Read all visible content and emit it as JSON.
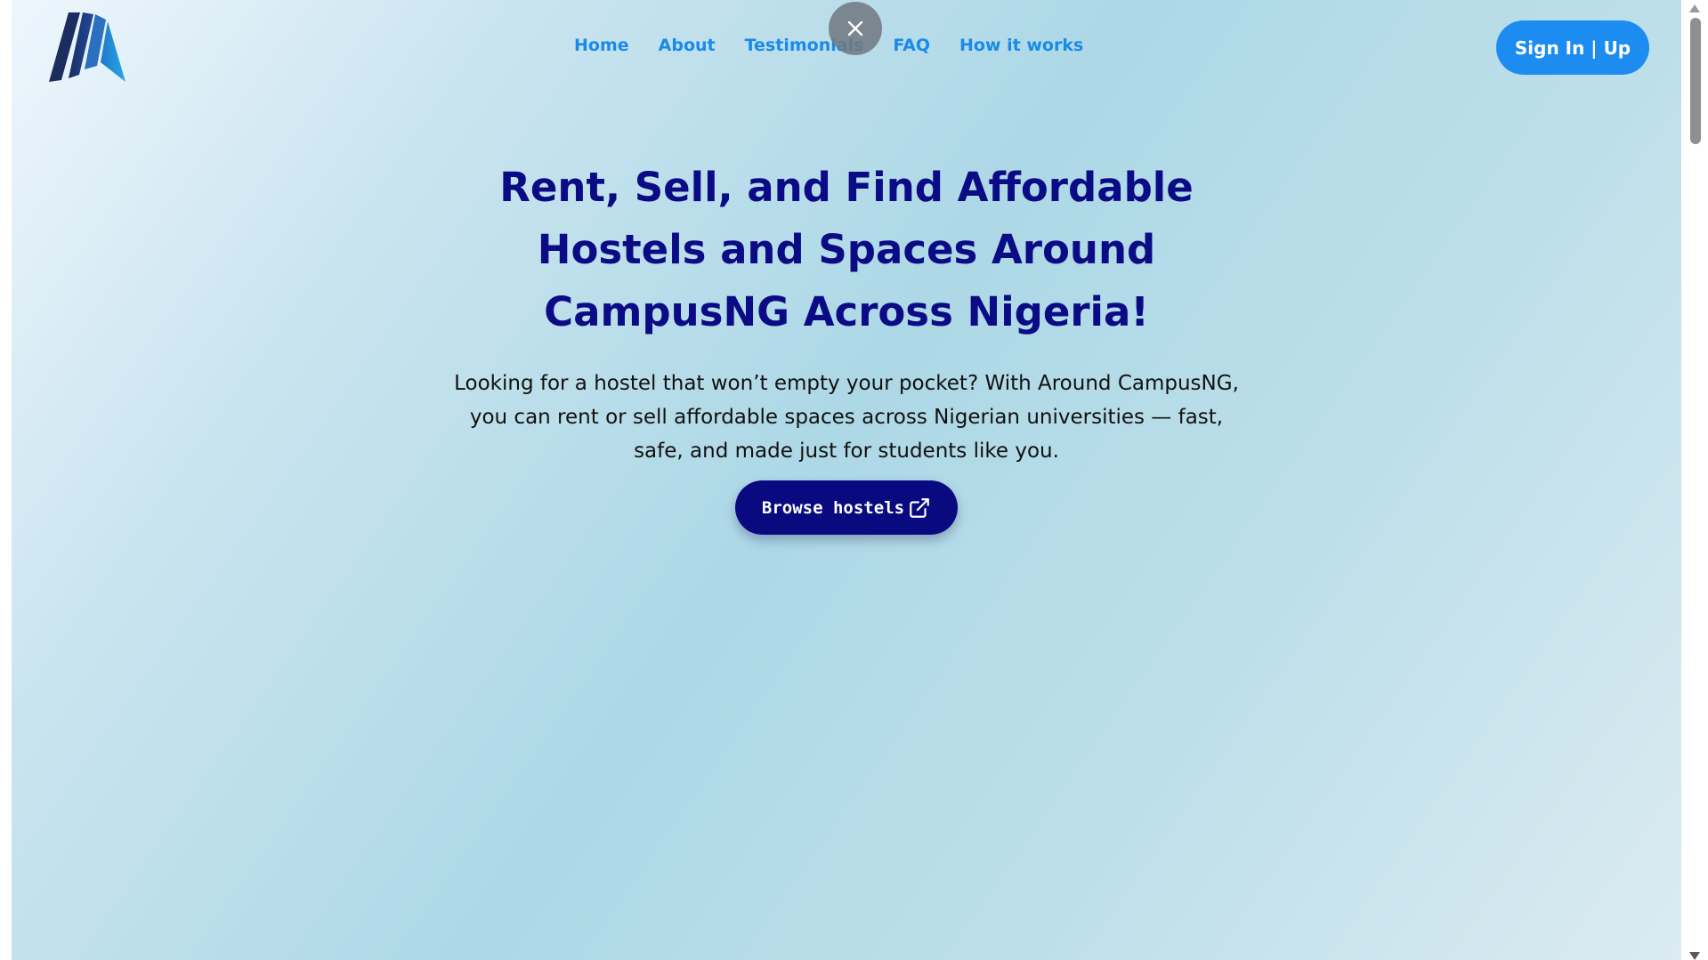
{
  "nav": {
    "items": [
      {
        "label": "Home"
      },
      {
        "label": "About"
      },
      {
        "label": "Testimonials"
      },
      {
        "label": "FAQ"
      },
      {
        "label": "How it works"
      }
    ]
  },
  "auth": {
    "label": "Sign In | Up"
  },
  "hero": {
    "title": "Rent, Sell, and Find Affordable Hostels and Spaces Around CampusNG Across Nigeria!",
    "description": "Looking for a hostel that won’t empty your pocket? With Around CampusNG, you can rent or sell affordable spaces across Nigerian universities — fast, safe, and made just for students like you.",
    "cta_label": "Browse hostels"
  },
  "icons": {
    "close": "close-icon",
    "external": "external-link-icon",
    "logo": "brand-logo"
  },
  "colors": {
    "primary_blue": "#1c8cf0",
    "navy": "#0b0b85",
    "nav_text": "#1a8ae8"
  }
}
